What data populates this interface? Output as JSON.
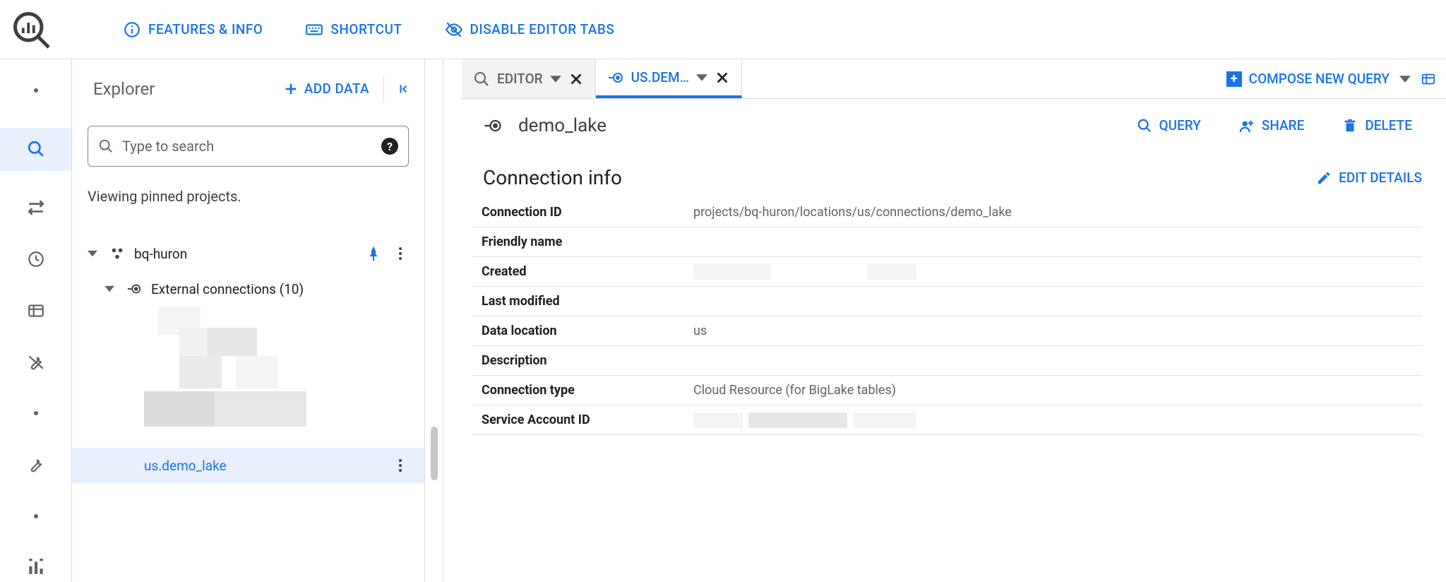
{
  "toolbar": {
    "featuresInfo": "FEATURES & INFO",
    "shortcut": "SHORTCUT",
    "disableTabs": "DISABLE EDITOR TABS"
  },
  "explorer": {
    "title": "Explorer",
    "addData": "ADD DATA",
    "searchPlaceholder": "Type to search",
    "viewingPinned": "Viewing pinned projects.",
    "project": "bq-huron",
    "externalConnections": "External connections (10)",
    "selectedConnection": "us.demo_lake"
  },
  "tabs": {
    "editor": "EDITOR",
    "conn": "US.DEM…"
  },
  "compose": {
    "label": "COMPOSE NEW QUERY"
  },
  "resource": {
    "title": "demo_lake",
    "actions": {
      "query": "QUERY",
      "share": "SHARE",
      "delete": "DELETE"
    }
  },
  "section": {
    "title": "Connection info",
    "edit": "EDIT DETAILS"
  },
  "info": {
    "rows": [
      {
        "k": "Connection ID",
        "v": "projects/bq-huron/locations/us/connections/demo_lake"
      },
      {
        "k": "Friendly name",
        "v": ""
      },
      {
        "k": "Created",
        "v": ""
      },
      {
        "k": "Last modified",
        "v": ""
      },
      {
        "k": "Data location",
        "v": "us"
      },
      {
        "k": "Description",
        "v": ""
      },
      {
        "k": "Connection type",
        "v": "Cloud Resource (for BigLake tables)"
      },
      {
        "k": "Service Account ID",
        "v": ""
      }
    ]
  }
}
